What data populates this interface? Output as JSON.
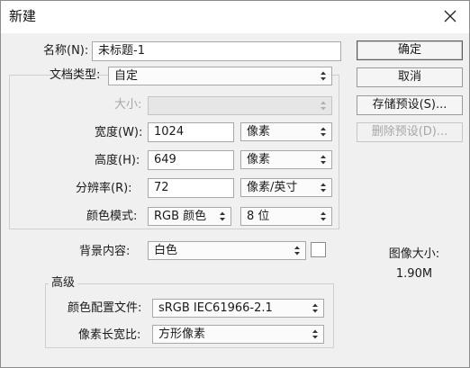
{
  "window": {
    "title": "新建"
  },
  "fields": {
    "name_label": "名称(N):",
    "name_value": "未标题-1",
    "doc_type_label": "文档类型:",
    "doc_type_value": "自定",
    "size_label": "大小:",
    "size_value": "",
    "width_label": "宽度(W):",
    "width_value": "1024",
    "width_unit": "像素",
    "height_label": "高度(H):",
    "height_value": "649",
    "height_unit": "像素",
    "resolution_label": "分辨率(R):",
    "resolution_value": "72",
    "resolution_unit": "像素/英寸",
    "color_mode_label": "颜色模式:",
    "color_mode_value": "RGB 颜色",
    "bit_depth_value": "8 位",
    "background_label": "背景内容:",
    "background_value": "白色"
  },
  "advanced": {
    "legend": "高级",
    "color_profile_label": "颜色配置文件:",
    "color_profile_value": "sRGB IEC61966-2.1",
    "pixel_aspect_label": "像素长宽比:",
    "pixel_aspect_value": "方形像素"
  },
  "buttons": {
    "ok": "确定",
    "cancel": "取消",
    "save_preset": "存储预设(S)...",
    "delete_preset": "删除预设(D)..."
  },
  "info": {
    "image_size_label": "图像大小:",
    "image_size_value": "1.90M"
  },
  "colors": {
    "window_bg": "#f0f0f0",
    "titlebar_bg": "#ffffff",
    "swatch": "#ffffff"
  }
}
